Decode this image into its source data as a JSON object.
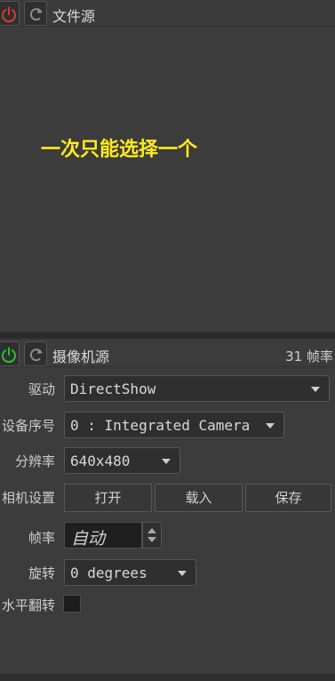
{
  "file_source": {
    "title": "文件源",
    "notice": "一次只能选择一个",
    "power_icon_color": "#d23c3c",
    "refresh_icon": "refresh-icon"
  },
  "camera_source": {
    "title": "摄像机源",
    "fps_text": "31 帧率",
    "power_icon_color": "#2cc02c",
    "fields": {
      "driver": {
        "label": "驱动",
        "value": "DirectShow"
      },
      "device": {
        "label": "设备序号",
        "value": "0 : Integrated Camera"
      },
      "resolution": {
        "label": "分辨率",
        "value": "640x480"
      },
      "camera_settings": {
        "label": "相机设置",
        "open": "打开",
        "load": "载入",
        "save": "保存"
      },
      "framerate": {
        "label": "帧率",
        "value": "自动"
      },
      "rotation": {
        "label": "旋转",
        "value": "0 degrees"
      },
      "flip": {
        "label": "水平翻转",
        "checked": false
      }
    }
  },
  "colors": {
    "notice": "#ffeb1e",
    "background": "#3c3c3c"
  }
}
